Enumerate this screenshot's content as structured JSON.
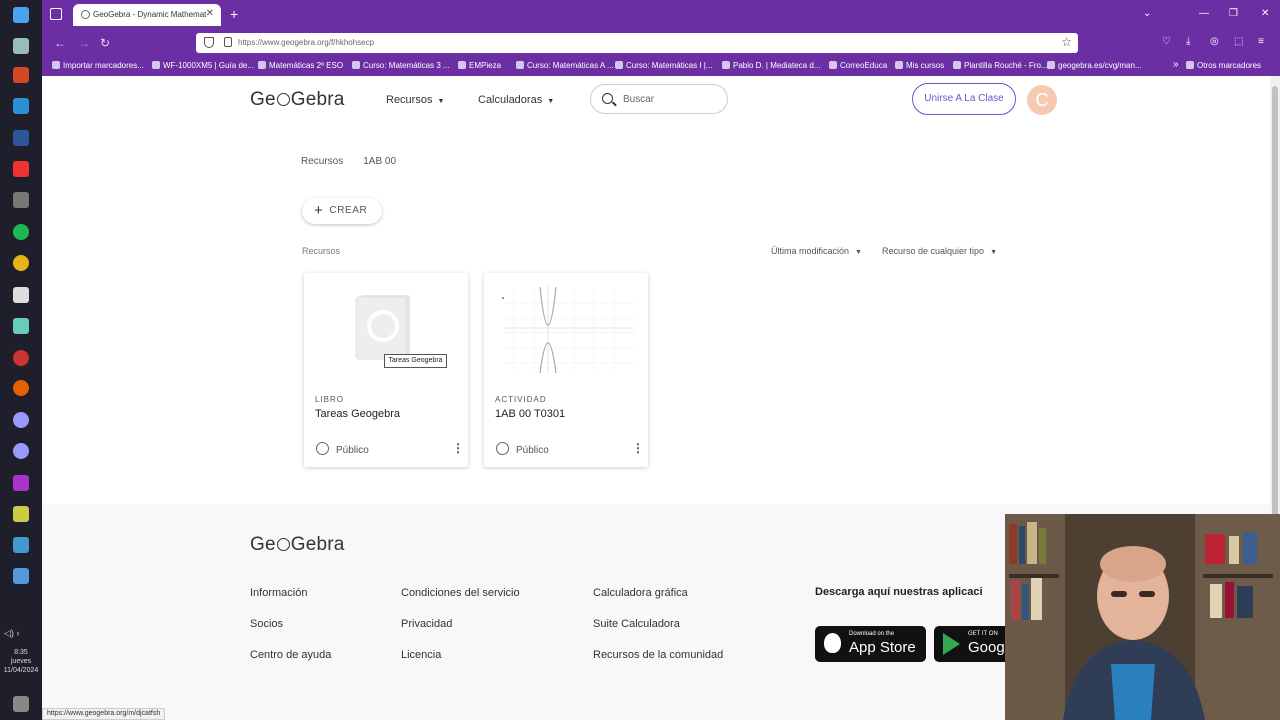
{
  "browser": {
    "tab_title": "GeoGebra - Dynamic Mathemat",
    "new_tab": "+",
    "url": "https://www.geogebra.org/f/hkhohsecp",
    "bookmarks": [
      "Importar marcadores...",
      "WF-1000XM5 | Guía de...",
      "Matemáticas 2º ESO",
      "Curso: Matemáticas 3 ...",
      "EMPieza",
      "Curso: Matemáticas A ...",
      "Curso: Matemáticas I |...",
      "Pablo D. | Mediateca d...",
      "CorreoEduca",
      "Mis cursos",
      "Plantilla Rouché - Fro...",
      "geogebra.es/cvg/man...",
      "Otros marcadores"
    ],
    "status_url": "https://www.geogebra.org/m/djcatfsh"
  },
  "taskbar": {
    "time": "8:35",
    "day": "jueves",
    "date": "11/04/2024"
  },
  "header": {
    "menu_resources": "Recursos",
    "menu_calculators": "Calculadoras",
    "search_placeholder": "Buscar",
    "join_class": "Unirse A La Clase",
    "avatar_letter": "C"
  },
  "breadcrumb": {
    "root": "Recursos",
    "current": "1AB 00"
  },
  "toolbar": {
    "create_label": "CREAR",
    "section_label": "Recursos",
    "sort_label": "Última modificación",
    "type_filter_label": "Recurso de cualquier tipo"
  },
  "cards": [
    {
      "type": "LIBRO",
      "title": "Tareas Geogebra",
      "visibility": "Público"
    },
    {
      "type": "ACTIVIDAD",
      "title": "1AB 00 T0301",
      "visibility": "Público"
    }
  ],
  "tooltip": "Tareas Geogebra",
  "footer": {
    "col1": [
      "Información",
      "Socios",
      "Centro de ayuda"
    ],
    "col2": [
      "Condiciones del servicio",
      "Privacidad",
      "Licencia"
    ],
    "col3": [
      "Calculadora gráfica",
      "Suite Calculadora",
      "Recursos de la comunidad"
    ],
    "download_heading": "Descarga aquí nuestras aplicaci",
    "appstore_small": "Download on the",
    "appstore_big": "App Store",
    "googleplay_small": "GET IT ON",
    "googleplay_big": "Goog"
  },
  "colors": {
    "browser_chrome": "#6b2fa3",
    "accent": "#6557d2",
    "avatar": "#f6c9b3"
  }
}
